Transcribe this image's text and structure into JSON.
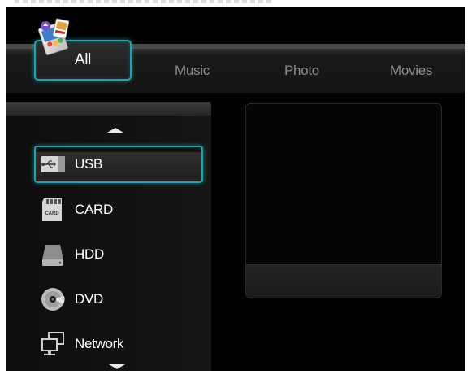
{
  "categories": {
    "tabs": [
      {
        "label": "All",
        "selected": true
      },
      {
        "label": "Music",
        "selected": false
      },
      {
        "label": "Photo",
        "selected": false
      },
      {
        "label": "Movies",
        "selected": false
      }
    ]
  },
  "sources": {
    "items": [
      {
        "label": "USB",
        "icon": "usb-icon",
        "selected": true
      },
      {
        "label": "CARD",
        "icon": "sd-card-icon",
        "card_text": "CARD",
        "selected": false
      },
      {
        "label": "HDD",
        "icon": "hdd-icon",
        "selected": false
      },
      {
        "label": "DVD",
        "icon": "dvd-icon",
        "selected": false
      },
      {
        "label": "Network",
        "icon": "network-icon",
        "selected": false
      }
    ]
  },
  "colors": {
    "focus_accent": "#1aa6b4",
    "background": "#000000",
    "inactive_tab_text": "#8d8d8d"
  }
}
